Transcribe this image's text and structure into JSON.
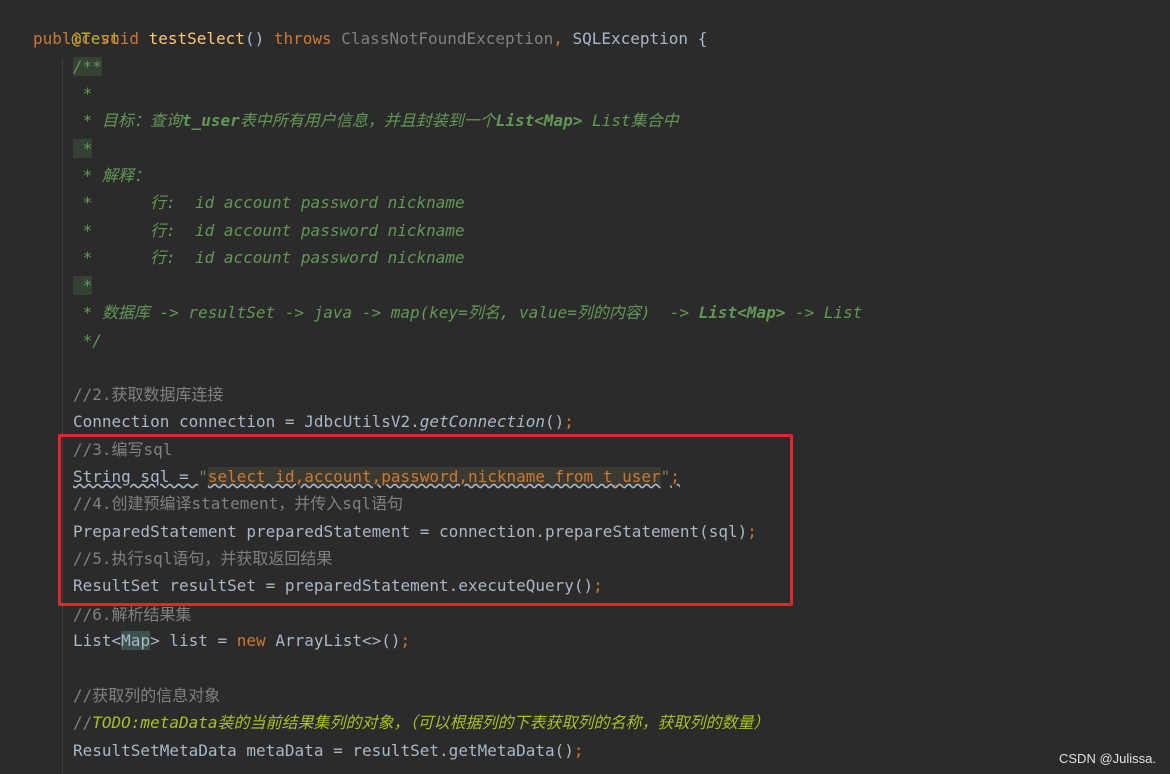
{
  "code": {
    "l1_annotation": "@Test",
    "l2_public": "public",
    "l2_void": "void",
    "l2_method": "testSelect",
    "l2_parens": "() ",
    "l2_throws": "throws",
    "l2_exc1": "ClassNotFoundException",
    "l2_comma": ", ",
    "l2_exc2": "SQLException",
    "l2_brace": " {",
    "d1": "/**",
    "d2": " *",
    "d3_star": " * ",
    "d3_text": "目标：查询",
    "d3_b1": "t_user",
    "d3_text2": "表中所有用户信息，并且封装到一个",
    "d3_b2": "List<Map>",
    "d3_b3": " List",
    "d3_text3": "集合中",
    "d4": " *",
    "d5": " * 解释：",
    "d6": " *      行:  id account password nickname",
    "d7": " *      行:  id account password nickname",
    "d8": " *      行:  id account password nickname",
    "d9": " *",
    "d10a": " * 数据库 -> resultSet -> java -> map(key=列名, value=列的内容)  -> ",
    "d10b": "List<Map>",
    "d10c": " -> ",
    "d10d": "List",
    "d11": " */",
    "c2": "//2.获取数据库连接",
    "conn_a": "Connection connection = JdbcUtilsV2.",
    "conn_b": "getConnection",
    "conn_c": "()",
    "semi": ";",
    "c3": "//3.编写sql",
    "sql_a": "String sql = ",
    "sql_q1": "\"",
    "sql_str": "select id,account,password,nickname from t_user",
    "sql_q2": "\"",
    "c4": "//4.创建预编译statement，并传入sql语句",
    "ps": "PreparedStatement preparedStatement = connection.prepareStatement(sql)",
    "c5": "//5.执行sql语句，并获取返回结果",
    "rs": "ResultSet resultSet = preparedStatement.executeQuery()",
    "c6": "//6.解析结果集",
    "list_a": "List<",
    "list_map": "Map",
    "list_b": "> list = ",
    "list_new": "new",
    "list_c": " ArrayList<>()",
    "c7": "//获取列的信息对象",
    "todo_slash": "//",
    "todo_text": "TODO:metaData装的当前结果集列的对象，（可以根据列的下表获取列的名称，获取列的数量）",
    "meta": "ResultSetMetaData metaData = resultSet.getMetaData()"
  },
  "watermark": "CSDN @Julissa."
}
